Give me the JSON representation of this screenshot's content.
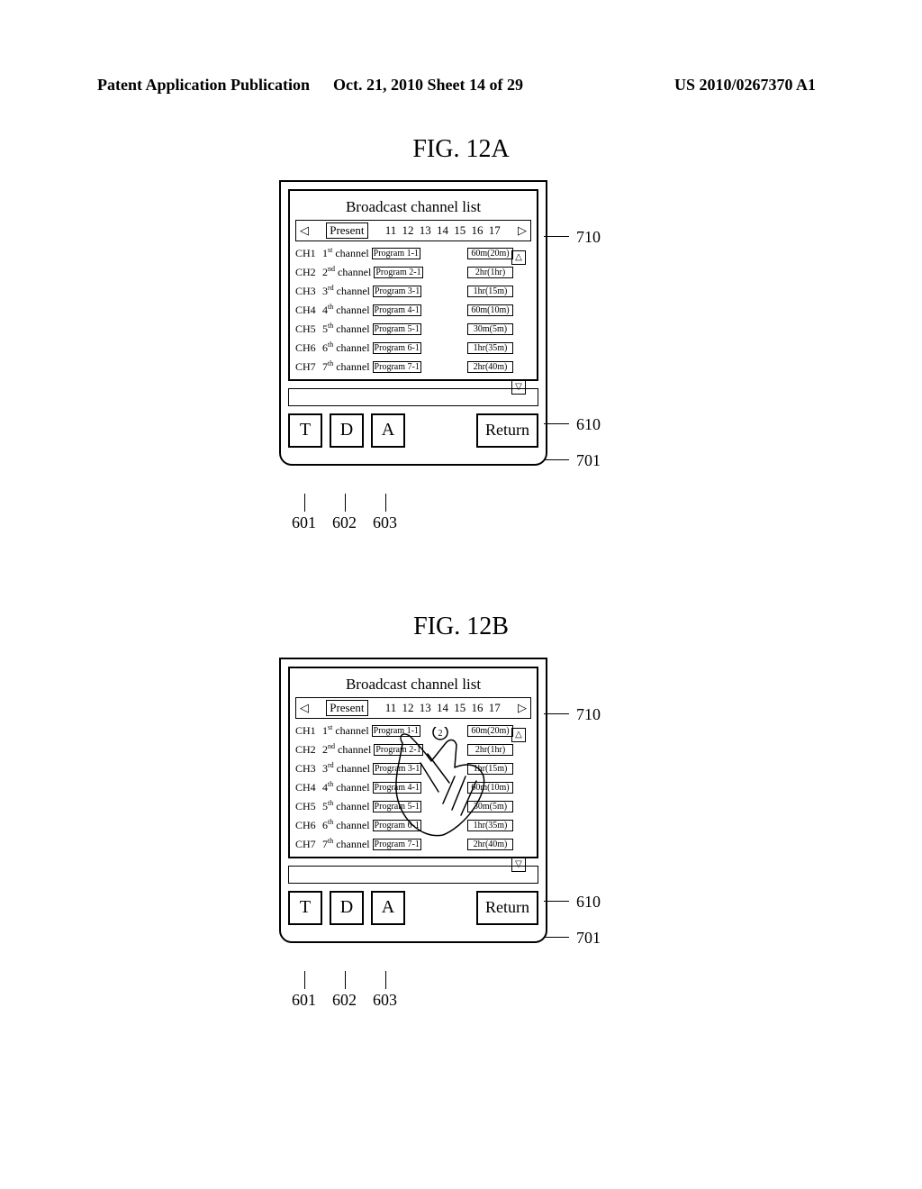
{
  "header": {
    "left": "Patent Application Publication",
    "middle": "Oct. 21, 2010  Sheet 14 of 29",
    "right": "US 2010/0267370 A1"
  },
  "figA": {
    "title": "FIG. 12A",
    "bc_title": "Broadcast channel list",
    "timeline_present": "Present",
    "timeline_nums": "11 12 13 14 15 16 17",
    "hand_label": "",
    "rows": [
      {
        "code": "CH1",
        "name_pref": "1",
        "name_sup": "st",
        "name_suf": " channel",
        "prog": "Program 1-1",
        "dur": "60m(20m)"
      },
      {
        "code": "CH2",
        "name_pref": "2",
        "name_sup": "nd",
        "name_suf": " channel",
        "prog": "Program 2-1",
        "dur": "2hr(1hr)"
      },
      {
        "code": "CH3",
        "name_pref": "3",
        "name_sup": "rd",
        "name_suf": " channel",
        "prog": "Program 3-1",
        "dur": "1hr(15m)"
      },
      {
        "code": "CH4",
        "name_pref": "4",
        "name_sup": "th",
        "name_suf": " channel",
        "prog": "Program 4-1",
        "dur": "60m(10m)"
      },
      {
        "code": "CH5",
        "name_pref": "5",
        "name_sup": "th",
        "name_suf": " channel",
        "prog": "Program 5-1",
        "dur": "30m(5m)"
      },
      {
        "code": "CH6",
        "name_pref": "6",
        "name_sup": "th",
        "name_suf": " channel",
        "prog": "Program 6-1",
        "dur": "1hr(35m)"
      },
      {
        "code": "CH7",
        "name_pref": "7",
        "name_sup": "th",
        "name_suf": " channel",
        "prog": "Program 7-1",
        "dur": "2hr(40m)"
      }
    ],
    "btn_t": "T",
    "btn_d": "D",
    "btn_a": "A",
    "btn_return": "Return",
    "callouts": {
      "c710": "710",
      "c610": "610",
      "c701": "701",
      "c601": "601",
      "c602": "602",
      "c603": "603"
    }
  },
  "figB": {
    "title": "FIG. 12B",
    "bc_title": "Broadcast channel list",
    "timeline_present": "Present",
    "timeline_nums": "11 12 13 14 15 16 17",
    "hand_label": "2",
    "rows": [
      {
        "code": "CH1",
        "name_pref": "1",
        "name_sup": "st",
        "name_suf": " channel",
        "prog": "Program 1-1",
        "dur": "60m(20m)"
      },
      {
        "code": "CH2",
        "name_pref": "2",
        "name_sup": "nd",
        "name_suf": " channel",
        "prog": "Program 2-1",
        "dur": "2hr(1hr)"
      },
      {
        "code": "CH3",
        "name_pref": "3",
        "name_sup": "rd",
        "name_suf": " channel",
        "prog": "Program 3-1",
        "dur": "1hr(15m)"
      },
      {
        "code": "CH4",
        "name_pref": "4",
        "name_sup": "th",
        "name_suf": " channel",
        "prog": "Program 4-1",
        "dur": "60m(10m)"
      },
      {
        "code": "CH5",
        "name_pref": "5",
        "name_sup": "th",
        "name_suf": " channel",
        "prog": "Program 5-1",
        "dur": "30m(5m)"
      },
      {
        "code": "CH6",
        "name_pref": "6",
        "name_sup": "th",
        "name_suf": " channel",
        "prog": "Program 6-1",
        "dur": "1hr(35m)"
      },
      {
        "code": "CH7",
        "name_pref": "7",
        "name_sup": "th",
        "name_suf": " channel",
        "prog": "Program 7-1",
        "dur": "2hr(40m)"
      }
    ],
    "btn_t": "T",
    "btn_d": "D",
    "btn_a": "A",
    "btn_return": "Return",
    "callouts": {
      "c710": "710",
      "c610": "610",
      "c701": "701",
      "c601": "601",
      "c602": "602",
      "c603": "603"
    }
  }
}
